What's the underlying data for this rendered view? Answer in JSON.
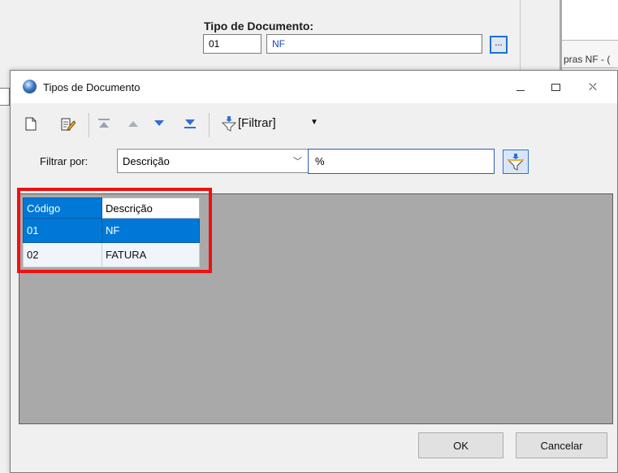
{
  "background": {
    "tipo_label": "Tipo de Documento:",
    "tipo_code_value": "01",
    "tipo_desc_value": "NF",
    "lookup_button_label": "...",
    "right_tab_text": "pras NF - ("
  },
  "dialog": {
    "title": "Tipos de Documento",
    "toolbar": {
      "filter_label": "[Filtrar]"
    },
    "filter": {
      "label": "Filtrar por:",
      "field_value": "Descrição",
      "text_value": "%"
    },
    "grid": {
      "columns": [
        "Código",
        "Descrição"
      ],
      "rows": [
        {
          "code": "01",
          "description": "NF",
          "selected": true
        },
        {
          "code": "02",
          "description": "FATURA",
          "selected": false
        }
      ]
    },
    "buttons": {
      "ok": "OK",
      "cancel": "Cancelar"
    }
  },
  "colors": {
    "selection": "#0078d7",
    "highlight": "#ee1111",
    "grid_background": "#a9a9a9"
  }
}
